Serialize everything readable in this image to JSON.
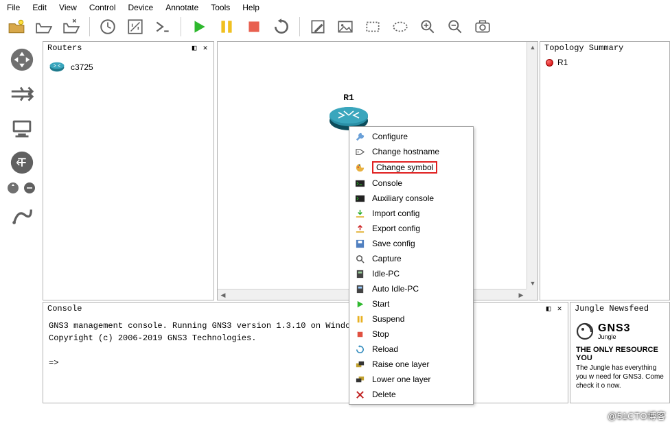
{
  "menu": {
    "items": [
      "File",
      "Edit",
      "View",
      "Control",
      "Device",
      "Annotate",
      "Tools",
      "Help"
    ]
  },
  "routers_panel": {
    "title": "Routers",
    "items": [
      {
        "label": "c3725"
      }
    ]
  },
  "canvas": {
    "nodes": [
      {
        "label": "R1"
      }
    ]
  },
  "topology_panel": {
    "title": "Topology Summary",
    "items": [
      {
        "label": "R1",
        "status": "stopped"
      }
    ]
  },
  "console_panel": {
    "title": "Console",
    "line1": "GNS3 management console. Running GNS3 version 1.3.10 on Windows (64-bit).",
    "line2": "Copyright (c) 2006-2019 GNS3 Technologies.",
    "prompt": "=>"
  },
  "newsfeed_panel": {
    "title": "Jungle Newsfeed",
    "brand_big": "GNS3",
    "brand_small": "Jungle",
    "headline": "THE ONLY RESOURCE YOU",
    "body": "The Jungle has everything you w need for GNS3. Come check it o now."
  },
  "context_menu": {
    "items": [
      {
        "label": "Configure",
        "highlight": false
      },
      {
        "label": "Change hostname",
        "highlight": false
      },
      {
        "label": "Change symbol",
        "highlight": true
      },
      {
        "label": "Console",
        "highlight": false
      },
      {
        "label": "Auxiliary console",
        "highlight": false
      },
      {
        "label": "Import config",
        "highlight": false
      },
      {
        "label": "Export config",
        "highlight": false
      },
      {
        "label": "Save config",
        "highlight": false
      },
      {
        "label": "Capture",
        "highlight": false
      },
      {
        "label": "Idle-PC",
        "highlight": false
      },
      {
        "label": "Auto Idle-PC",
        "highlight": false
      },
      {
        "label": "Start",
        "highlight": false
      },
      {
        "label": "Suspend",
        "highlight": false
      },
      {
        "label": "Stop",
        "highlight": false
      },
      {
        "label": "Reload",
        "highlight": false
      },
      {
        "label": "Raise one layer",
        "highlight": false
      },
      {
        "label": "Lower one layer",
        "highlight": false
      },
      {
        "label": "Delete",
        "highlight": false
      }
    ]
  },
  "watermark": "@51CTO博客"
}
